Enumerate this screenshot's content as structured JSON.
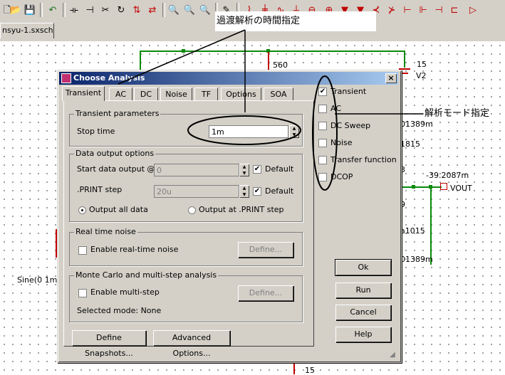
{
  "document_tab": "nsyu-1.sxsch",
  "schematic": {
    "labels": {
      "r_560": "560",
      "v_15_top": "15",
      "v2": "V2",
      "val_1389_a": "01389m",
      "val_1815": "1815",
      "val_3": "3",
      "val_neg": "-39.2087m",
      "vout": "VOUT",
      "val_9": "9",
      "val_1015": "a1015",
      "val_1389_b": "01389m",
      "sine": "Sine(0 1m",
      "v_15_bottom": "15"
    }
  },
  "annotations": {
    "top_note": "過渡解析の時間指定",
    "right_note": "解析モード指定"
  },
  "dialog": {
    "title": "Choose Analysis",
    "close": "×",
    "tabs": [
      "Transient",
      "AC",
      "DC",
      "Noise",
      "TF",
      "Options",
      "SOA"
    ],
    "active_tab": "Transient",
    "transient_params": {
      "group_title": "Transient parameters",
      "stop_time_label": "Stop time",
      "stop_time_value": "1m"
    },
    "data_output": {
      "group_title": "Data output options",
      "start_label": "Start data output @",
      "start_value": "0",
      "start_default": "Default",
      "print_label": ".PRINT step",
      "print_value": "20u",
      "print_default": "Default",
      "radio_all": "Output all data",
      "radio_print": "Output at .PRINT step"
    },
    "realtime": {
      "group_title": "Real time noise",
      "enable_label": "Enable real-time noise",
      "define": "Define..."
    },
    "montecarlo": {
      "group_title": "Monte Carlo and multi-step analysis",
      "enable_label": "Enable multi-step",
      "define": "Define...",
      "selected_mode": "Selected mode: None"
    },
    "bottom_buttons": {
      "snapshots": "Define Snapshots...",
      "advanced": "Advanced Options..."
    },
    "modes": [
      {
        "label": "Transient",
        "checked": true
      },
      {
        "label": "AC",
        "checked": false
      },
      {
        "label": "DC Sweep",
        "checked": false
      },
      {
        "label": "Noise",
        "checked": false
      },
      {
        "label": "Transfer function",
        "checked": false
      },
      {
        "label": "DCOP",
        "checked": false
      }
    ],
    "actions": {
      "ok": "Ok",
      "run": "Run",
      "cancel": "Cancel",
      "help": "Help"
    }
  },
  "toolbar_icons": [
    "new-icon",
    "open-icon",
    "save-icon",
    "undo-icon",
    "wire-icon",
    "probe-icon",
    "cut-icon",
    "rotate-icon",
    "mirror-icon",
    "delete-icon",
    "zoom-in-icon",
    "zoom-out-icon",
    "zoom-fit-icon",
    "pencil-icon",
    "resistor-icon",
    "capacitor-icon",
    "inductor-icon",
    "ground-icon",
    "source-icon",
    "diode-icon",
    "zener-icon",
    "npn-icon",
    "pnp-icon",
    "nmos-icon",
    "pmos-icon",
    "jfet-icon",
    "opamp-icon"
  ]
}
